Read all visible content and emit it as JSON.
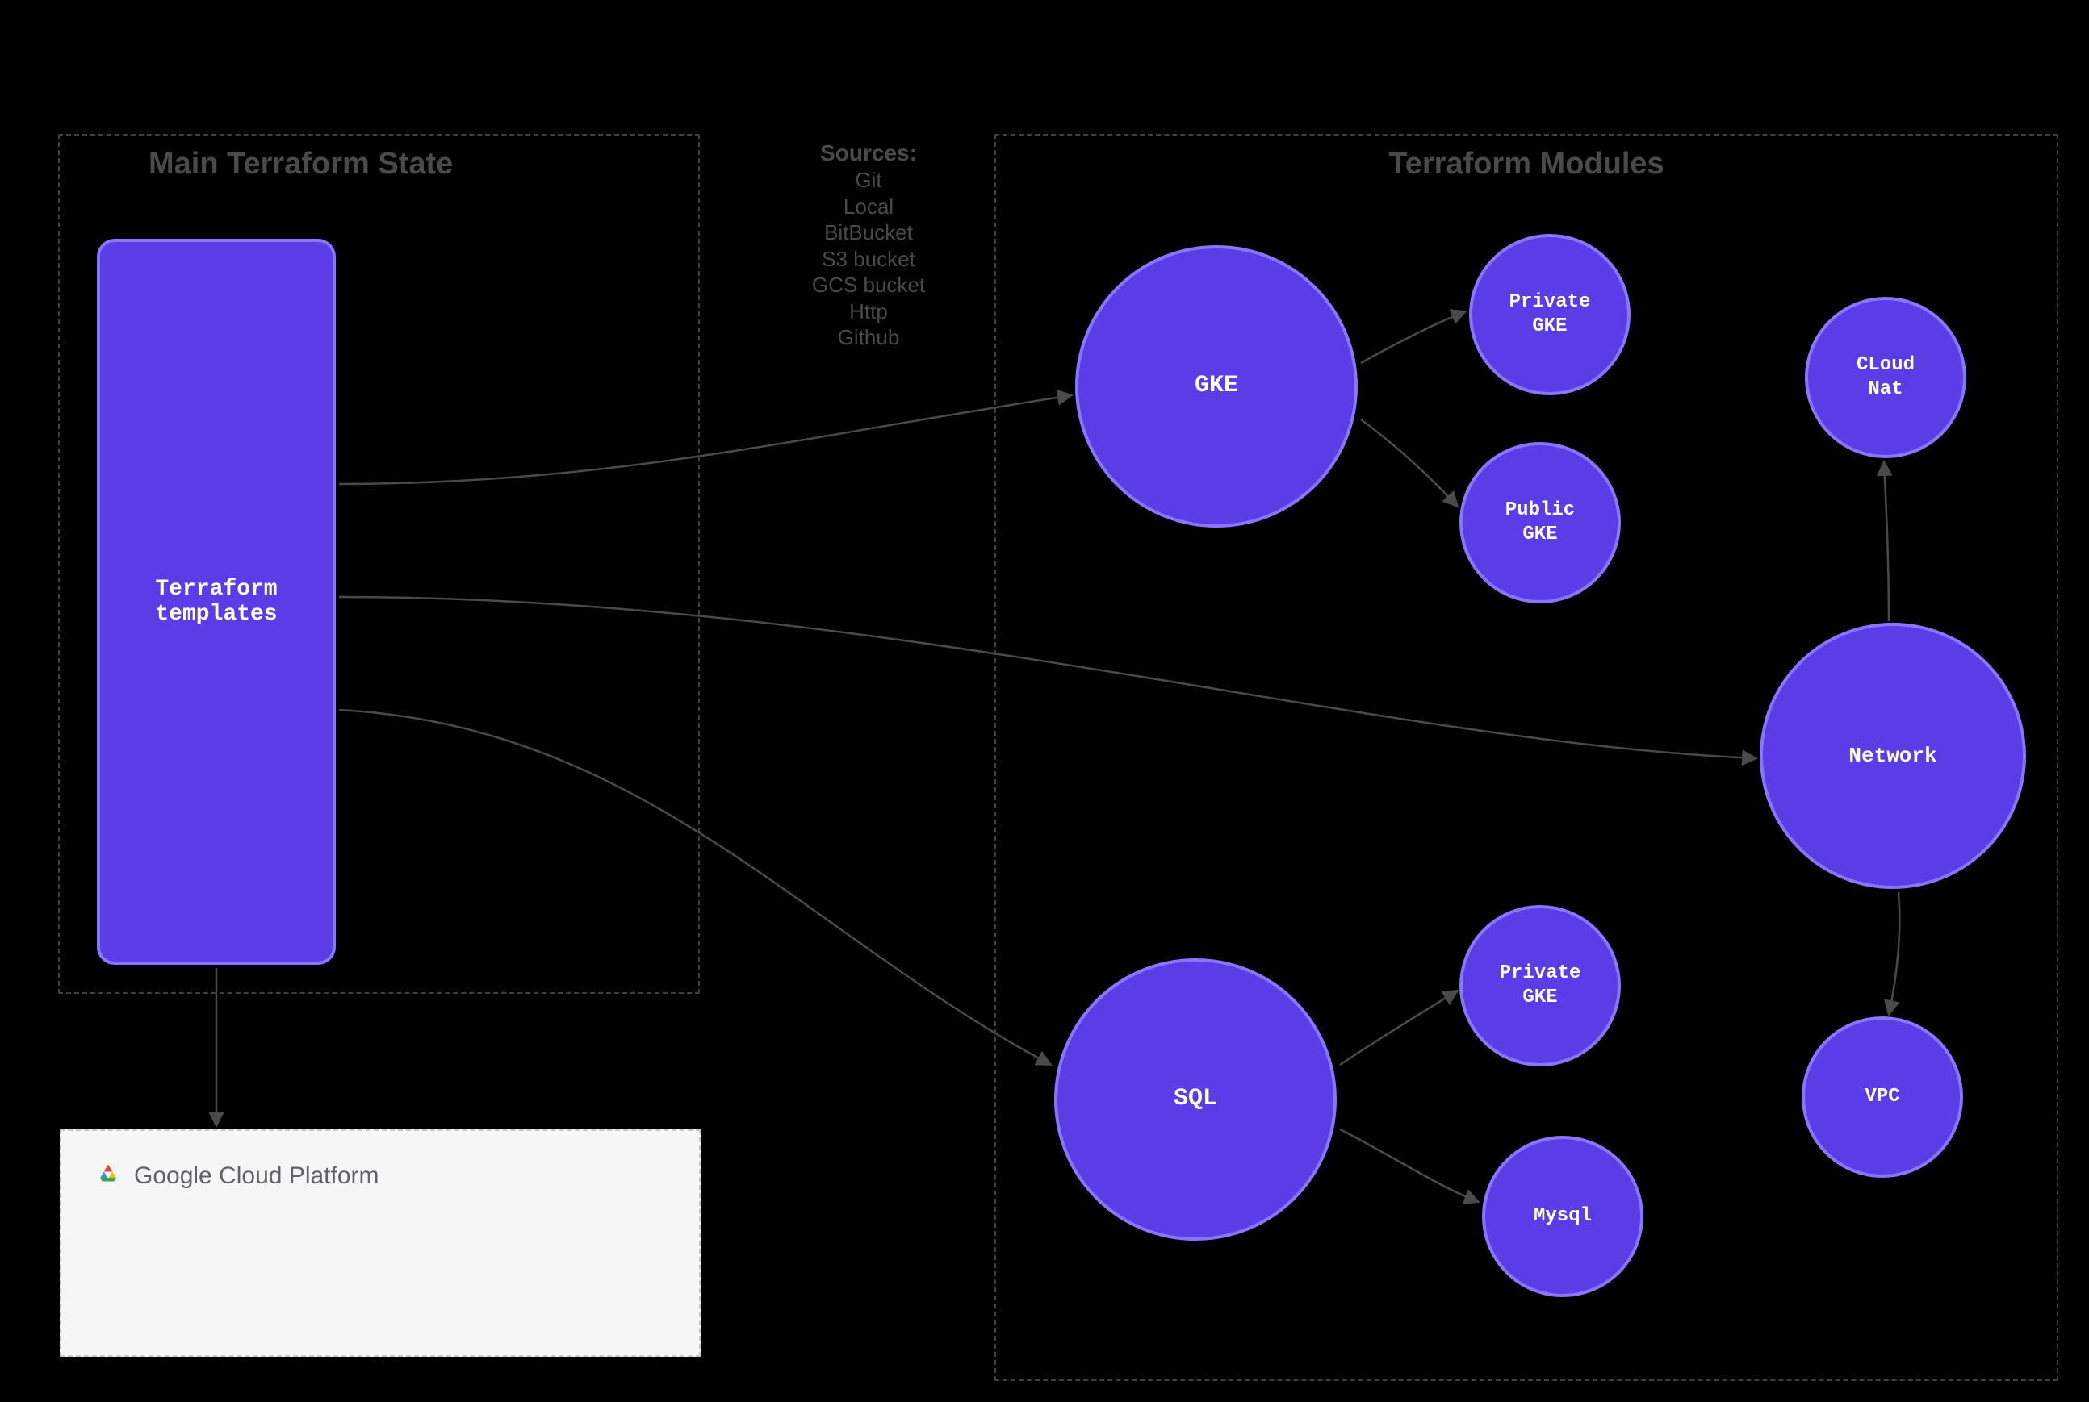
{
  "state_box": {
    "title": "Main Terraform State"
  },
  "modules_box": {
    "title": "Terraform Modules"
  },
  "sources": {
    "heading": "Sources:",
    "items": [
      "Git",
      "Local",
      "BitBucket",
      "S3 bucket",
      "GCS bucket",
      "Http",
      "Github"
    ]
  },
  "tf_templates": {
    "label": "Terraform\ntemplates"
  },
  "nodes": {
    "gke": {
      "label": "GKE"
    },
    "private_gke": {
      "label": "Private\nGKE"
    },
    "public_gke": {
      "label": "Public\nGKE"
    },
    "cloud_nat": {
      "label": "CLoud\nNat"
    },
    "network": {
      "label": "Network"
    },
    "sql": {
      "label": "SQL"
    },
    "private_gke2": {
      "label": "Private\nGKE"
    },
    "mysql": {
      "label": "Mysql"
    },
    "vpc": {
      "label": "VPC"
    }
  },
  "gcp": {
    "brand": "Google",
    "rest": "Cloud Platform"
  },
  "colors": {
    "node_fill": "#5a3de6",
    "node_border": "#8a75ff"
  }
}
